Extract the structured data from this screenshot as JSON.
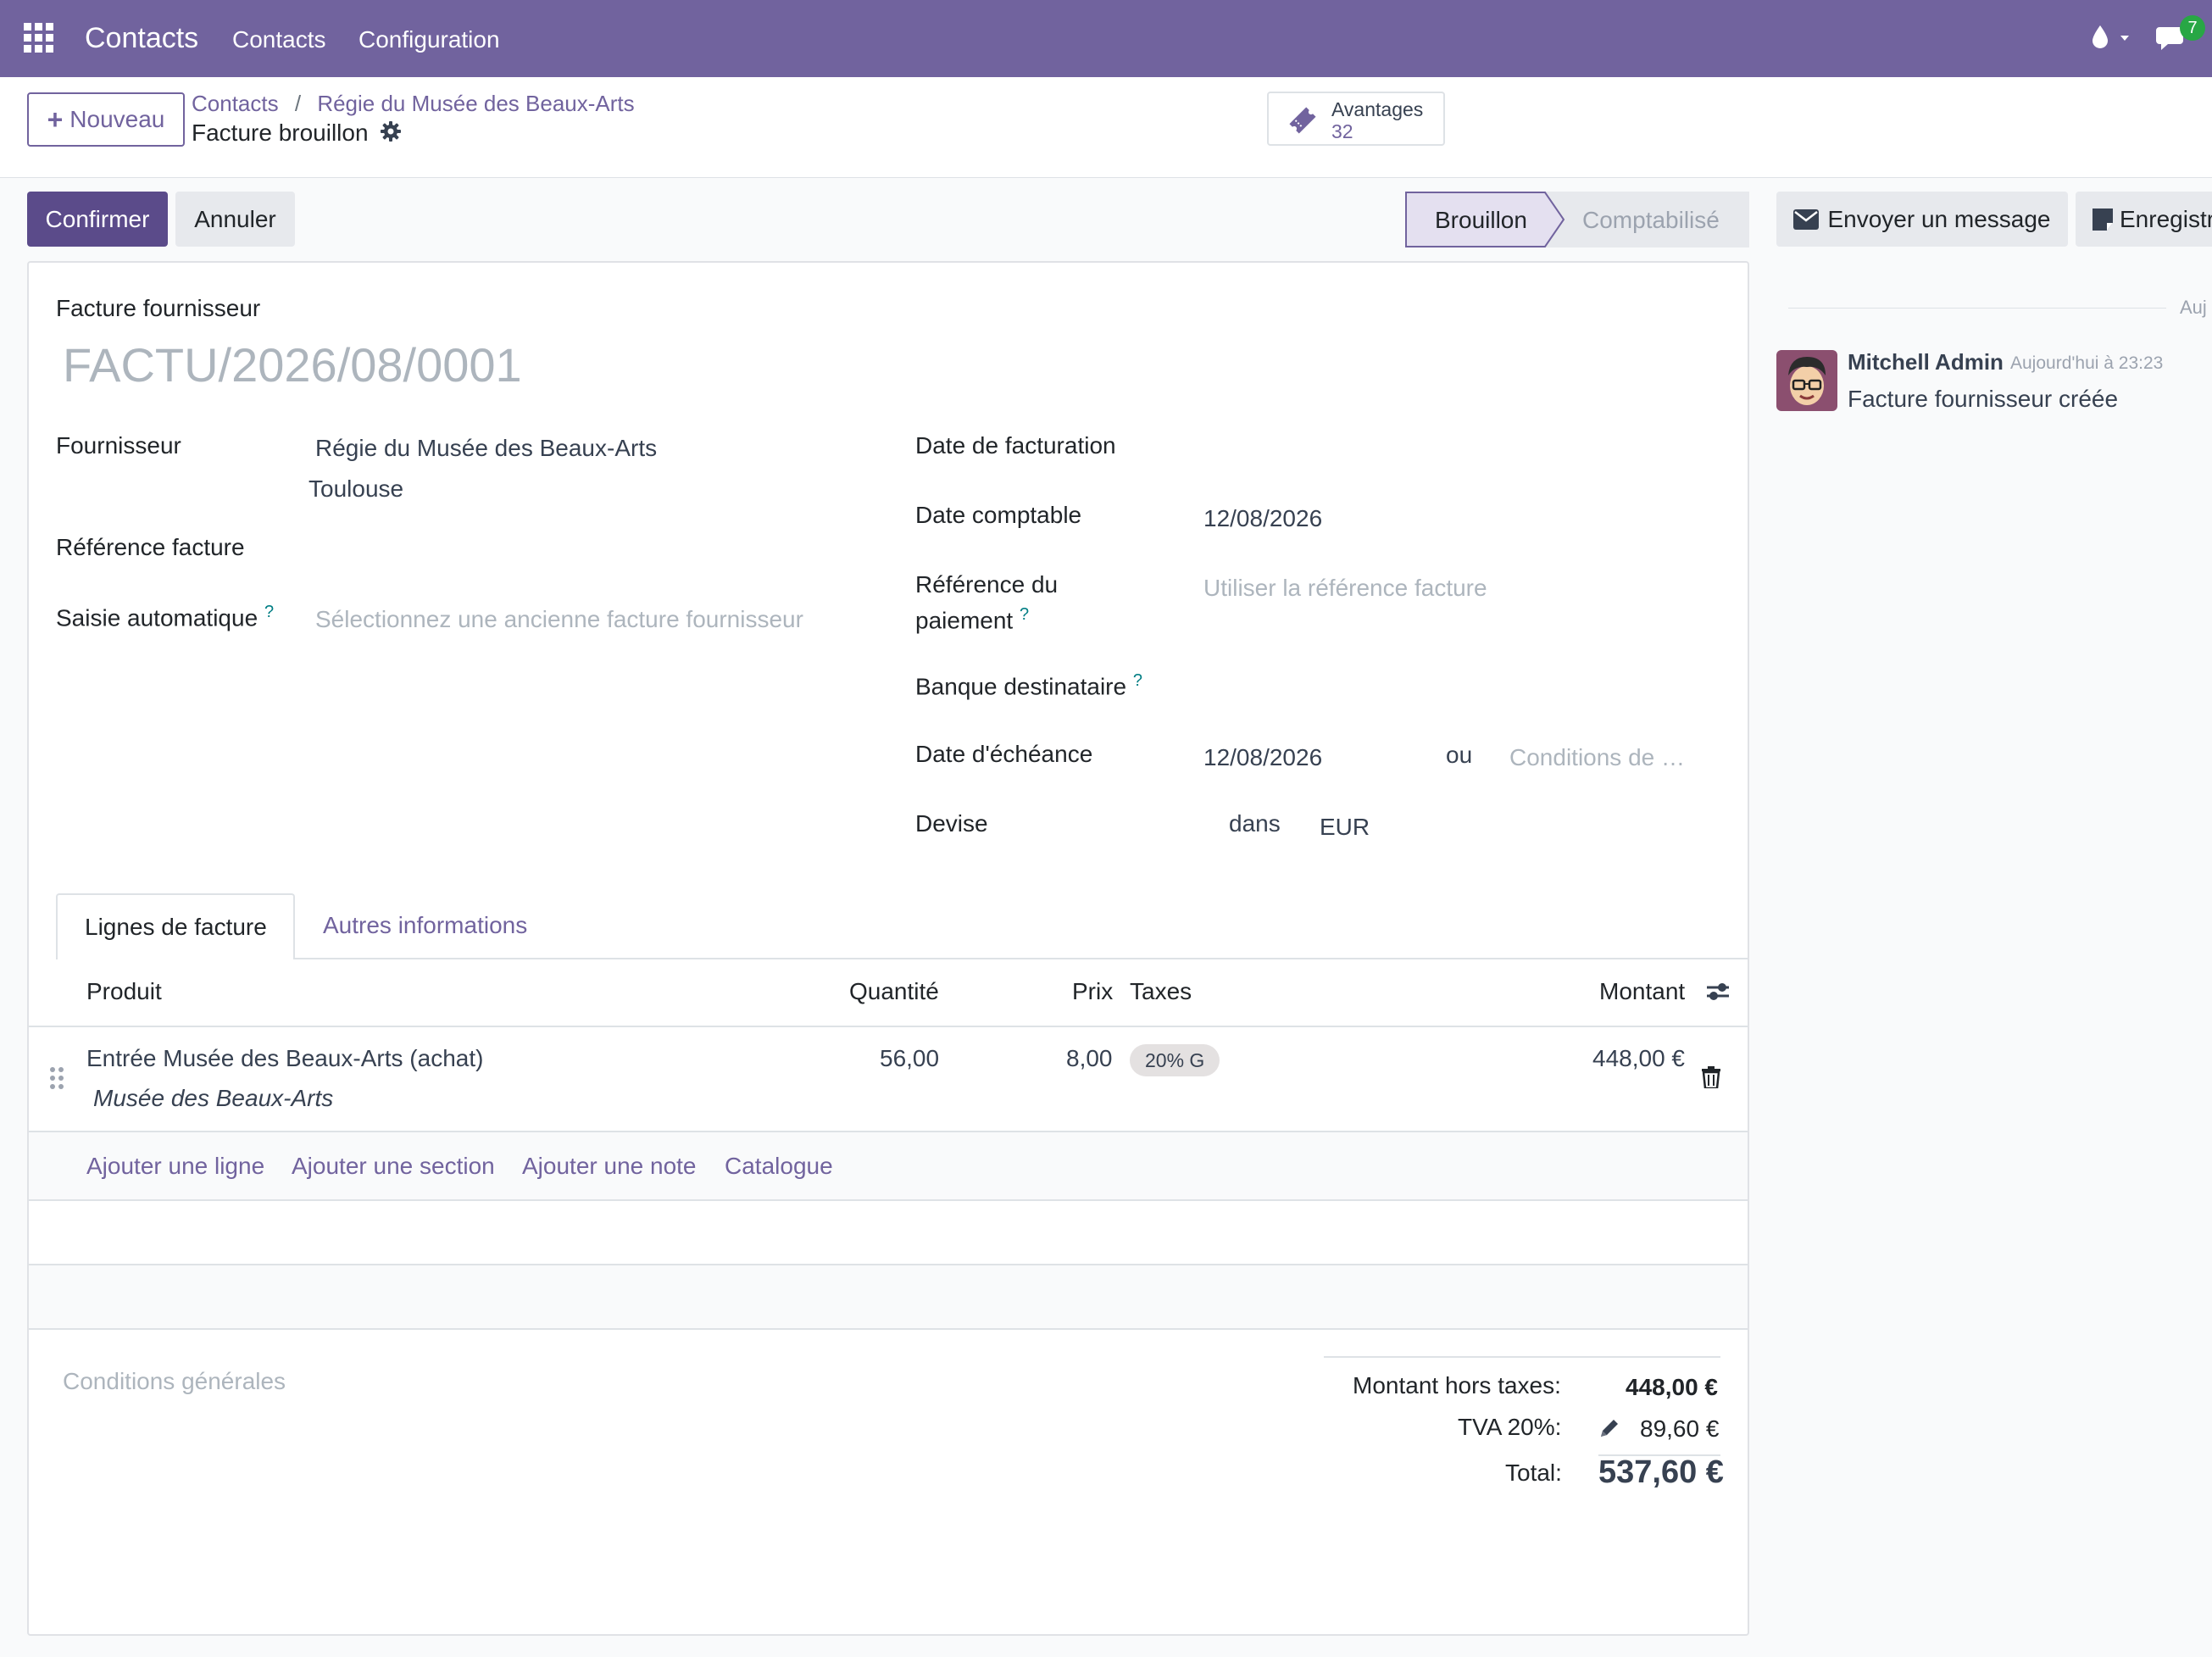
{
  "navbar": {
    "app_title": "Contacts",
    "menu": [
      "Contacts",
      "Configuration"
    ],
    "chat_badge": "7"
  },
  "control_panel": {
    "new_button": "Nouveau",
    "breadcrumb": [
      "Contacts",
      "Régie du Musée des Beaux-Arts"
    ],
    "record_title": "Facture brouillon",
    "smart_button": {
      "label": "Avantages",
      "count": "32"
    }
  },
  "statusbar": {
    "confirm": "Confirmer",
    "cancel": "Annuler",
    "stages": [
      "Brouillon",
      "Comptabilisé"
    ]
  },
  "chatter": {
    "send_message": "Envoyer un message",
    "log_note": "Enregistr",
    "date_separator": "Auj",
    "message": {
      "author": "Mitchell Admin",
      "time": "Aujourd'hui à 23:23",
      "body": "Facture fournisseur créée"
    }
  },
  "form": {
    "doc_type": "Facture fournisseur",
    "name_placeholder": "FACTU/2026/08/0001",
    "left": {
      "vendor_label": "Fournisseur",
      "vendor_name": "Régie du Musée des Beaux-Arts",
      "vendor_city": "Toulouse",
      "ref_label": "Référence facture",
      "auto_label": "Saisie automatique",
      "auto_help": "?",
      "auto_placeholder": "Sélectionnez une ancienne facture fournisseur"
    },
    "right": {
      "invoice_date_label": "Date de facturation",
      "accounting_date_label": "Date comptable",
      "accounting_date": "12/08/2026",
      "payment_ref_label_1": "Référence du",
      "payment_ref_label_2": "paiement",
      "payment_ref_help": "?",
      "payment_ref_placeholder": "Utiliser la référence facture",
      "bank_label": "Banque destinataire",
      "bank_help": "?",
      "due_date_label": "Date d'échéance",
      "due_date": "12/08/2026",
      "or": "ou",
      "terms_placeholder": "Conditions de …",
      "currency_label": "Devise",
      "currency_in": "dans",
      "currency": "EUR"
    },
    "tabs": [
      "Lignes de facture",
      "Autres informations"
    ],
    "table": {
      "headers": {
        "product": "Produit",
        "qty": "Quantité",
        "price": "Prix",
        "taxes": "Taxes",
        "amount": "Montant"
      },
      "rows": [
        {
          "product": "Entrée Musée des Beaux-Arts (achat)",
          "description": "Musée des Beaux-Arts",
          "qty": "56,00",
          "price": "8,00",
          "tax": "20% G",
          "amount": "448,00 €"
        }
      ],
      "add_links": [
        "Ajouter une ligne",
        "Ajouter une section",
        "Ajouter une note",
        "Catalogue"
      ]
    },
    "terms_placeholder": "Conditions générales",
    "totals": {
      "untaxed_label": "Montant hors taxes:",
      "untaxed": "448,00 €",
      "vat_label": "TVA 20%:",
      "vat": "89,60 €",
      "total_label": "Total:",
      "total": "537,60 €"
    }
  },
  "colors": {
    "brand": "#71639e",
    "primary_button": "#5b4b8a"
  }
}
